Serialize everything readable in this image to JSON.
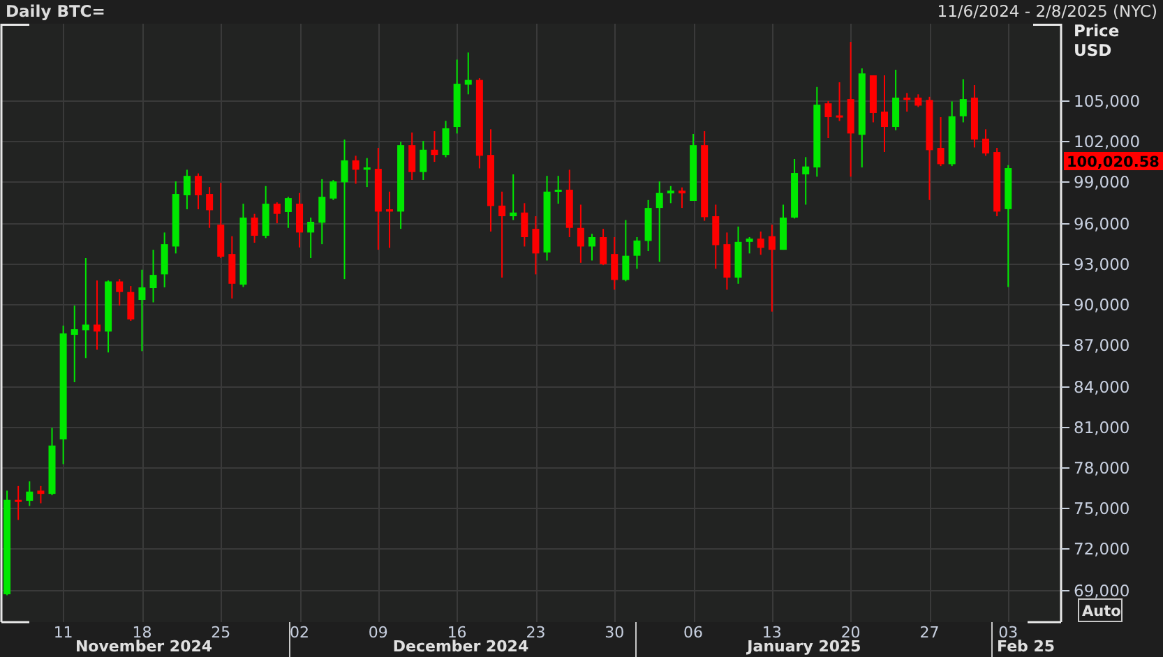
{
  "header": {
    "title": "Daily BTC=",
    "range": "11/6/2024 - 2/8/2025 (NYC)"
  },
  "chart": {
    "price_label": "Price",
    "currency_label": "USD",
    "last_price": "100,020.58",
    "auto_button": "Auto",
    "months": [
      "November 2024",
      "December 2024",
      "January 2025",
      "Feb 25"
    ],
    "chart_data": {
      "type": "candlestick",
      "grid": true,
      "ylim": [
        66600,
        110650
      ],
      "categories": [
        null,
        null,
        null,
        null,
        null,
        "11",
        null,
        null,
        null,
        null,
        null,
        null,
        "18",
        null,
        null,
        null,
        null,
        null,
        null,
        "25",
        null,
        null,
        null,
        null,
        null,
        null,
        "02",
        null,
        null,
        null,
        null,
        null,
        null,
        "09",
        null,
        null,
        null,
        null,
        null,
        null,
        "16",
        null,
        null,
        null,
        null,
        null,
        null,
        "23",
        null,
        null,
        null,
        null,
        null,
        null,
        "30",
        null,
        null,
        null,
        null,
        null,
        null,
        "06",
        null,
        null,
        null,
        null,
        null,
        null,
        "13",
        null,
        null,
        null,
        null,
        null,
        null,
        "20",
        null,
        null,
        null,
        null,
        null,
        null,
        "27",
        null,
        null,
        null,
        null,
        null,
        null,
        "03"
      ],
      "yticks": [
        {
          "value": 105000,
          "label": "105,000"
        },
        {
          "value": 102000,
          "label": "102,000"
        },
        {
          "value": 99000,
          "label": "99,000"
        },
        {
          "value": 96000,
          "label": "96,000"
        },
        {
          "value": 93000,
          "label": "93,000"
        },
        {
          "value": 90000,
          "label": "90,000"
        },
        {
          "value": 87000,
          "label": "87,000"
        },
        {
          "value": 84000,
          "label": "84,000"
        },
        {
          "value": 81000,
          "label": "81,000"
        },
        {
          "value": 78000,
          "label": "78,000"
        },
        {
          "value": 75000,
          "label": "75,000"
        },
        {
          "value": 72000,
          "label": "72,000"
        },
        {
          "value": 69000,
          "label": "69,000"
        }
      ],
      "ohlc": [
        [
          68650,
          76280,
          68580,
          75600
        ],
        [
          75600,
          76620,
          74120,
          75500
        ],
        [
          75530,
          76960,
          75150,
          76210
        ],
        [
          76280,
          76620,
          75350,
          76040
        ],
        [
          76040,
          80900,
          75940,
          79600
        ],
        [
          80050,
          88430,
          78230,
          87850
        ],
        [
          87750,
          89900,
          84260,
          88160
        ],
        [
          88090,
          93400,
          86040,
          88500
        ],
        [
          88500,
          91750,
          86650,
          87990
        ],
        [
          87990,
          91750,
          86450,
          91680
        ],
        [
          91680,
          91850,
          89900,
          90900
        ],
        [
          90900,
          91340,
          88780,
          88880
        ],
        [
          90320,
          92540,
          86550,
          91240
        ],
        [
          91190,
          94010,
          90140,
          92160
        ],
        [
          92200,
          95280,
          91240,
          94420
        ],
        [
          94250,
          99040,
          93740,
          98120
        ],
        [
          98020,
          99900,
          96990,
          99450
        ],
        [
          99450,
          99630,
          96990,
          98020
        ],
        [
          98120,
          98630,
          95620,
          96920
        ],
        [
          95860,
          98940,
          93400,
          93500
        ],
        [
          93700,
          95010,
          90420,
          91510
        ],
        [
          91440,
          97400,
          91270,
          96380
        ],
        [
          96380,
          96650,
          94530,
          95040
        ],
        [
          95040,
          98700,
          94870,
          97400
        ],
        [
          97400,
          97500,
          95960,
          96650
        ],
        [
          96790,
          97910,
          95620,
          97810
        ],
        [
          97400,
          98190,
          94180,
          95280
        ],
        [
          95280,
          96380,
          93400,
          96070
        ],
        [
          96000,
          99210,
          94420,
          97910
        ],
        [
          97780,
          99140,
          97670,
          99040
        ],
        [
          98980,
          102120,
          91850,
          100590
        ],
        [
          100590,
          100930,
          98870,
          99900
        ],
        [
          99900,
          100760,
          98630,
          100070
        ],
        [
          99970,
          101510,
          94010,
          96820
        ],
        [
          96990,
          98290,
          94150,
          96820
        ],
        [
          96820,
          101950,
          95550,
          101710
        ],
        [
          101710,
          102640,
          99150,
          99730
        ],
        [
          99730,
          102020,
          99150,
          101370
        ],
        [
          101370,
          102740,
          100480,
          100990
        ],
        [
          100990,
          103500,
          100820,
          102950
        ],
        [
          103050,
          108010,
          102570,
          106230
        ],
        [
          106160,
          108530,
          105450,
          106510
        ],
        [
          106510,
          106640,
          100000,
          100930
        ],
        [
          100990,
          102880,
          95350,
          97230
        ],
        [
          97260,
          98290,
          91960,
          96480
        ],
        [
          96480,
          99560,
          96200,
          96750
        ],
        [
          96750,
          97440,
          94250,
          94940
        ],
        [
          95550,
          96480,
          92200,
          93740
        ],
        [
          93810,
          99450,
          93220,
          98290
        ],
        [
          98290,
          99450,
          97400,
          98430
        ],
        [
          98430,
          99900,
          94940,
          95620
        ],
        [
          95620,
          97330,
          93050,
          94250
        ],
        [
          94250,
          95180,
          93220,
          94940
        ],
        [
          94940,
          95550,
          92880,
          92950
        ],
        [
          93700,
          94940,
          91070,
          91790
        ],
        [
          91790,
          96200,
          91690,
          93570
        ],
        [
          93570,
          94940,
          92610,
          94690
        ],
        [
          94660,
          97670,
          93910,
          97090
        ],
        [
          97090,
          99040,
          93120,
          98190
        ],
        [
          98160,
          98700,
          97440,
          98360
        ],
        [
          98360,
          98600,
          97090,
          98160
        ],
        [
          97610,
          102540,
          97610,
          101710
        ],
        [
          101710,
          102740,
          96140,
          96410
        ],
        [
          96480,
          97330,
          92610,
          94350
        ],
        [
          94420,
          95280,
          91070,
          91960
        ],
        [
          91960,
          95720,
          91510,
          94590
        ],
        [
          94590,
          94940,
          93740,
          94830
        ],
        [
          94830,
          95350,
          93640,
          94150
        ],
        [
          95010,
          95860,
          89460,
          94010
        ],
        [
          94010,
          97330,
          94010,
          96380
        ],
        [
          96380,
          100690,
          96310,
          99660
        ],
        [
          99560,
          100830,
          97330,
          100140
        ],
        [
          100070,
          105990,
          99390,
          104690
        ],
        [
          104790,
          104960,
          102230,
          103770
        ],
        [
          103900,
          106340,
          103490,
          103740
        ],
        [
          105100,
          109310,
          99390,
          102570
        ],
        [
          102470,
          107360,
          100070,
          106990
        ],
        [
          106850,
          106850,
          103390,
          104080
        ],
        [
          104180,
          106850,
          101200,
          103050
        ],
        [
          103050,
          107260,
          102810,
          105210
        ],
        [
          105210,
          105550,
          104180,
          105040
        ],
        [
          105210,
          105450,
          104520,
          104620
        ],
        [
          105040,
          105270,
          97670,
          101340
        ],
        [
          101510,
          103770,
          100170,
          100310
        ],
        [
          100310,
          104930,
          100170,
          103840
        ],
        [
          103840,
          106570,
          103390,
          105100
        ],
        [
          105210,
          106130,
          101540,
          102120
        ],
        [
          102190,
          102880,
          100930,
          101100
        ],
        [
          101200,
          101510,
          96480,
          96820
        ],
        [
          97000,
          100240,
          91270,
          100020.58
        ]
      ]
    }
  }
}
